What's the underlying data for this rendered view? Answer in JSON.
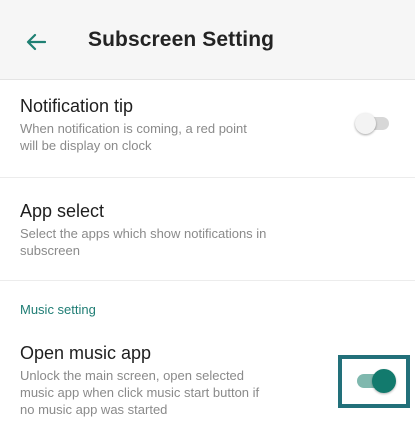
{
  "app_bar": {
    "back_icon": "arrow-left-icon",
    "title": "Subscreen Setting"
  },
  "settings": {
    "notification_tip": {
      "title": "Notification tip",
      "summary_line1": "When notification is coming, a red point",
      "summary_line2": "will be display on clock",
      "toggle_state": "off"
    },
    "app_select": {
      "title": "App select",
      "summary_line1": "Select the apps which show notifications in",
      "summary_line2": "subscreen"
    },
    "music_section": {
      "header": "Music setting"
    },
    "open_music_app": {
      "title": "Open music app",
      "summary_line1": "Unlock the main screen, open selected",
      "summary_line2": "music app when click music start button if",
      "summary_line3": "no music app was started",
      "toggle_state": "on"
    }
  },
  "colors": {
    "accent": "#127a6d",
    "accent_track": "#7fb8ae",
    "section_header": "#1f7d74",
    "highlight_border": "#22707a",
    "app_bar_bg": "#f6f6f6"
  }
}
